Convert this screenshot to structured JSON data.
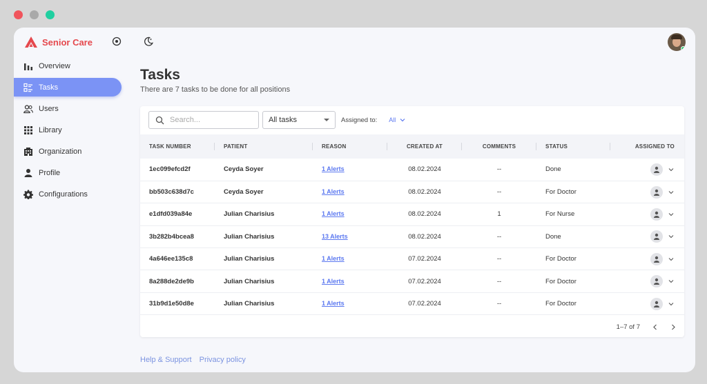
{
  "window_controls": {
    "close": "#f0545c",
    "minimize": "#a9a9a9",
    "maximize": "#20cfa0"
  },
  "brand": {
    "name": "Senior Care",
    "color": "#e5484d",
    "icon": "triangle-logo"
  },
  "top_icons": [
    "record-icon",
    "moon-icon"
  ],
  "sidebar": {
    "items": [
      {
        "label": "Overview",
        "icon": "bar-chart-icon",
        "active": false
      },
      {
        "label": "Tasks",
        "icon": "task-list-icon",
        "active": true
      },
      {
        "label": "Users",
        "icon": "users-icon",
        "active": false
      },
      {
        "label": "Library",
        "icon": "grid-icon",
        "active": false
      },
      {
        "label": "Organization",
        "icon": "building-icon",
        "active": false
      },
      {
        "label": "Profile",
        "icon": "person-icon",
        "active": false
      },
      {
        "label": "Configurations",
        "icon": "gear-icon",
        "active": false
      }
    ]
  },
  "page": {
    "title": "Tasks",
    "subtitle": "There are 7 tasks to be done for all positions"
  },
  "toolbar": {
    "search_placeholder": "Search...",
    "filter_value": "All tasks",
    "assigned_label": "Assigned to:",
    "assigned_value": "All"
  },
  "table": {
    "columns": [
      "TASK NUMBER",
      "PATIENT",
      "REASON",
      "CREATED AT",
      "COMMENTS",
      "STATUS",
      "ASSIGNED TO"
    ],
    "rows": [
      {
        "task": "1ec099efcd2f",
        "patient": "Ceyda Soyer",
        "reason": "1 Alerts",
        "created": "08.02.2024",
        "comments": "--",
        "status": "Done"
      },
      {
        "task": "bb503c638d7c",
        "patient": "Ceyda Soyer",
        "reason": "1 Alerts",
        "created": "08.02.2024",
        "comments": "--",
        "status": "For Doctor"
      },
      {
        "task": "e1dfd039a84e",
        "patient": "Julian Charisius",
        "reason": "1 Alerts",
        "created": "08.02.2024",
        "comments": "1",
        "status": "For Nurse"
      },
      {
        "task": "3b282b4bcea8",
        "patient": "Julian Charisius",
        "reason": "13 Alerts",
        "created": "08.02.2024",
        "comments": "--",
        "status": "Done"
      },
      {
        "task": "4a646ee135c8",
        "patient": "Julian Charisius",
        "reason": "1 Alerts",
        "created": "07.02.2024",
        "comments": "--",
        "status": "For Doctor"
      },
      {
        "task": "8a288de2de9b",
        "patient": "Julian Charisius",
        "reason": "1 Alerts",
        "created": "07.02.2024",
        "comments": "--",
        "status": "For Doctor"
      },
      {
        "task": "31b9d1e50d8e",
        "patient": "Julian Charisius",
        "reason": "1 Alerts",
        "created": "07.02.2024",
        "comments": "--",
        "status": "For Doctor"
      }
    ]
  },
  "pagination": {
    "range": "1–7 of 7"
  },
  "footer": {
    "help": "Help & Support",
    "privacy": "Privacy policy"
  },
  "colors": {
    "accent": "#7b93f5",
    "link": "#5b78f0",
    "background": "#f6f7fb"
  }
}
